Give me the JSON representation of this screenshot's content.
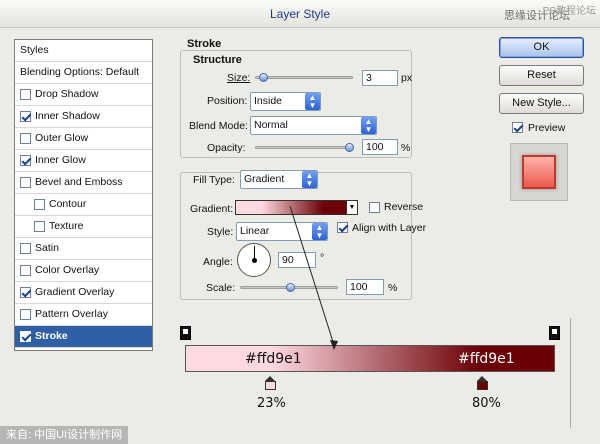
{
  "window": {
    "title": "Layer Style",
    "watermark_top": "思缘设计论坛",
    "watermark_top_right": "PS教程论坛"
  },
  "styles_panel": {
    "header": "Styles",
    "items": [
      {
        "label": "Blending Options: Default",
        "checkbox": false,
        "checked": false,
        "indent": false,
        "selected": false
      },
      {
        "label": "Drop Shadow",
        "checkbox": true,
        "checked": false,
        "indent": false,
        "selected": false
      },
      {
        "label": "Inner Shadow",
        "checkbox": true,
        "checked": true,
        "indent": false,
        "selected": false
      },
      {
        "label": "Outer Glow",
        "checkbox": true,
        "checked": false,
        "indent": false,
        "selected": false
      },
      {
        "label": "Inner Glow",
        "checkbox": true,
        "checked": true,
        "indent": false,
        "selected": false
      },
      {
        "label": "Bevel and Emboss",
        "checkbox": true,
        "checked": false,
        "indent": false,
        "selected": false
      },
      {
        "label": "Contour",
        "checkbox": true,
        "checked": false,
        "indent": true,
        "selected": false
      },
      {
        "label": "Texture",
        "checkbox": true,
        "checked": false,
        "indent": true,
        "selected": false
      },
      {
        "label": "Satin",
        "checkbox": true,
        "checked": false,
        "indent": false,
        "selected": false
      },
      {
        "label": "Color Overlay",
        "checkbox": true,
        "checked": false,
        "indent": false,
        "selected": false
      },
      {
        "label": "Gradient Overlay",
        "checkbox": true,
        "checked": true,
        "indent": false,
        "selected": false
      },
      {
        "label": "Pattern Overlay",
        "checkbox": true,
        "checked": false,
        "indent": false,
        "selected": false
      },
      {
        "label": "Stroke",
        "checkbox": true,
        "checked": true,
        "indent": false,
        "selected": true
      }
    ]
  },
  "stroke": {
    "title": "Stroke",
    "structure_title": "Structure",
    "size_label": "Size:",
    "size_value": "3",
    "size_unit": "px",
    "size_fraction": 0.03,
    "position_label": "Position:",
    "position_value": "Inside",
    "blend_label": "Blend Mode:",
    "blend_value": "Normal",
    "opacity_label": "Opacity:",
    "opacity_value": "100",
    "opacity_unit": "%",
    "opacity_fraction": 1.0,
    "filltype_label": "Fill Type:",
    "filltype_value": "Gradient",
    "gradient_label": "Gradient:",
    "reverse_label": "Reverse",
    "reverse_checked": false,
    "style_label": "Style:",
    "style_value": "Linear",
    "align_label": "Align with Layer",
    "align_checked": true,
    "angle_label": "Angle:",
    "angle_value": "90",
    "angle_unit": "°",
    "scale_label": "Scale:",
    "scale_value": "100",
    "scale_unit": "%",
    "scale_fraction": 0.5
  },
  "buttons": {
    "ok": "OK",
    "reset": "Reset",
    "new_style": "New Style...",
    "preview_label": "Preview",
    "preview_checked": true
  },
  "gradient_detail": {
    "left_color_text": "#ffd9e1",
    "right_color_text": "#ffd9e1",
    "left_stop_pct": "23%",
    "right_stop_pct": "80%",
    "left_color": "#ffd9e1",
    "right_color": "#6a0005"
  },
  "bottom_watermark": "来自: 中国UI设计制作网"
}
